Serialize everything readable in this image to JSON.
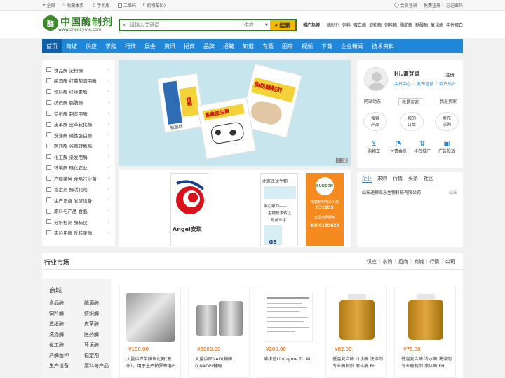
{
  "topbar": {
    "left": [
      "全国",
      "收藏本页",
      "手机版",
      "二维码",
      "购物车(0)"
    ],
    "right": [
      "会员登录",
      "免费注册",
      "忘记密码"
    ]
  },
  "logo": {
    "name": "中国酶制剂",
    "url": "www.cnenzyme.com",
    "mark": "酶"
  },
  "search": {
    "placeholder": "请输入关键词",
    "type": "供应",
    "button": "搜索"
  },
  "hot": {
    "label": "推广热搜：",
    "items": [
      "酶制剂",
      "饲料",
      "蛋白酶",
      "淀粉酶",
      "饲料酶",
      "脂肪酶",
      "糖酸酶",
      "氧化酶",
      "中性蛋白"
    ]
  },
  "nav": [
    "首页",
    "商城",
    "供应",
    "求购",
    "行情",
    "展会",
    "资讯",
    "招商",
    "品牌",
    "招聘",
    "知道",
    "专题",
    "图库",
    "视频",
    "下载",
    "企业新闻",
    "技术资料"
  ],
  "sidebar": [
    "食品酶 淀粉酶",
    "酿酒酶 红葡萄酒用酶",
    "饲料酶 纤维素酶",
    "纺织酶 脂肪酶",
    "造纸酶 制浆用酶",
    "皮革酶 皮革软化酶",
    "洗涤酶 碱性蛋白酶",
    "医药酶 谷丙转氨酶",
    "化工酶 染发用酶",
    "环境酶 硅化农业",
    "产酶菌种 食品行业菌",
    "稳定剂 酶活化剂",
    "生产设备 发酵设备",
    "原料与产品 食品",
    "分析检测 酶标仪",
    "实验用酶 反转录酶"
  ],
  "banner": {
    "pages": [
      "1",
      "2"
    ],
    "box1": [
      "植物",
      "抗菌肽"
    ],
    "box2": [
      "脂肪酶制剂"
    ],
    "box3": [
      "畜禽益生素"
    ]
  },
  "ads": {
    "angel": {
      "brand": "Angel",
      "cn": "安琪"
    },
    "beijing": {
      "title": "北京泛球生物",
      "line1": "凝心聚力——",
      "line2": "生物技术转让",
      "line3": "与商业化",
      "gb": "GB"
    },
    "sunson": {
      "logo": "SUNSON",
      "line1": "梅塞制剂可以少量",
      "line2": "831835",
      "line3": "全国免费服务",
      "line4": "4006181628"
    }
  },
  "user": {
    "greeting": "Hi,请登录",
    "register": "注册",
    "links": [
      "会员中心",
      "发布信息",
      "商户后台"
    ],
    "tabs": [
      "网站动态",
      "我是买家",
      "我是卖家"
    ],
    "circles": [
      [
        "搜索",
        "产品"
      ],
      [
        "我的",
        "订单"
      ],
      [
        "发布",
        "求购"
      ]
    ],
    "tools": [
      "购物车",
      "付费会员",
      "排名推广",
      "广告投放"
    ]
  },
  "company": {
    "tabs": [
      "企业",
      "求购",
      "行情",
      "头条",
      "社区"
    ],
    "row": {
      "name": "山东通椰凯乐生物科技有限公司",
      "region": "山东"
    }
  },
  "market": {
    "title": "行业市场",
    "links": [
      "供应",
      "求购",
      "招商",
      "商城",
      "行情",
      "公司"
    ],
    "cat_title": "商城",
    "cats": [
      "食品酶",
      "酿酒酶",
      "饲料酶",
      "纺织酶",
      "造纸酶",
      "皮革酶",
      "洗涤酶",
      "医药酶",
      "化工酶",
      "环境酶",
      "产酶菌种",
      "稳定剂",
      "生产设备",
      "原料与产品"
    ],
    "products": [
      {
        "price": "¥100.00",
        "name": "大量供应单胺氧化酶(液体），用于生产柏罗布洛P"
      },
      {
        "price": "¥5000.00",
        "name": "大量供应NAD(辅酶I),NADP(辅酶II),FAD,UDPG,N"
      },
      {
        "price": "¥200.00",
        "name": "诺维信Lipozyme TL IM"
      },
      {
        "price": "¥82.00",
        "name": "低温复合酶 冷水酶 洗涤剂专业酶制剂 液体酶 FH"
      },
      {
        "price": "¥75.00",
        "name": "低温复合酶 冷水酶 洗涤剂专业酶制剂 液体酶 FH"
      }
    ]
  },
  "colors": {
    "nav": "#1f86d8",
    "brand": "#2e7d22",
    "search_button": "#f5b700",
    "price": "#e05a00"
  }
}
